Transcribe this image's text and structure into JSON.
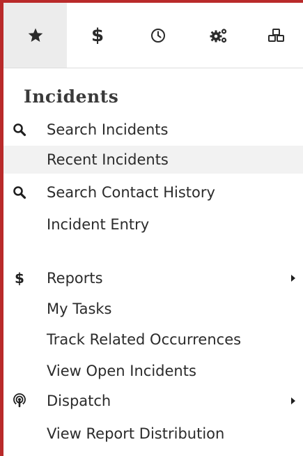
{
  "tabs": [
    {
      "id": "favorites",
      "icon": "star-icon",
      "active": true
    },
    {
      "id": "money",
      "icon": "dollar-icon",
      "glyph": "$",
      "active": false
    },
    {
      "id": "history",
      "icon": "clock-icon",
      "active": false
    },
    {
      "id": "settings",
      "icon": "gears-icon",
      "active": false
    },
    {
      "id": "modules",
      "icon": "cubes-icon",
      "active": false
    }
  ],
  "menu": {
    "header": "Incidents",
    "items": [
      {
        "label": "Search Incidents",
        "icon": "search-icon"
      },
      {
        "label": "Recent Incidents",
        "icon": ""
      },
      {
        "label": "Search Contact History",
        "icon": "search-icon"
      },
      {
        "label": "Incident Entry",
        "icon": ""
      },
      {
        "label": "Reports",
        "icon": "dollar-icon",
        "glyph": "$",
        "submenu": true
      },
      {
        "label": "My Tasks",
        "icon": ""
      },
      {
        "label": "Track Related Occurrences",
        "icon": ""
      },
      {
        "label": "View Open Incidents",
        "icon": ""
      },
      {
        "label": "Dispatch",
        "icon": "podcast-icon",
        "submenu": true
      },
      {
        "label": "View Report Distribution",
        "icon": ""
      }
    ]
  },
  "colors": {
    "frame": "#b92a2a",
    "active_tab_bg": "#ececec",
    "highlight_row_bg": "#f2f2f2",
    "text": "#2b2b2b"
  }
}
